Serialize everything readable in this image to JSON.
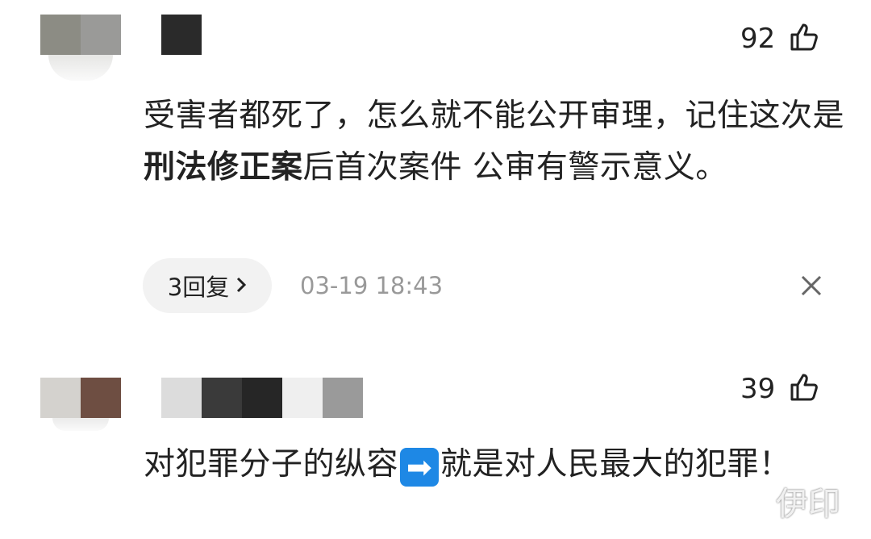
{
  "comments": [
    {
      "likes": "92",
      "text_parts": [
        "受害者都死了，怎么就不能公开审理，记住这次是",
        "刑法修正案",
        "后首次案件 公审有警示意义。"
      ],
      "reply_label": "3回复",
      "timestamp": "03-19 18:43",
      "avatar_colors": [
        "#8c8c84",
        "#9a9a98"
      ],
      "name_colors": [
        "#2a2a2a"
      ]
    },
    {
      "likes": "39",
      "text_before": "对犯罪分子的纵容",
      "arrow_emoji": "➡",
      "text_after": "就是对人民最大的犯罪！",
      "avatar_colors": [
        "#d4d2ce",
        "#6e4e42"
      ],
      "name_colors": [
        "#dcdcdc",
        "#3a3a3a",
        "#262626",
        "#efefef",
        "#9a9a9a"
      ]
    }
  ],
  "watermark": "伊印",
  "icons": {
    "like": "thumbs-up-icon",
    "close": "close-icon",
    "chevron": "chevron-right-icon"
  }
}
